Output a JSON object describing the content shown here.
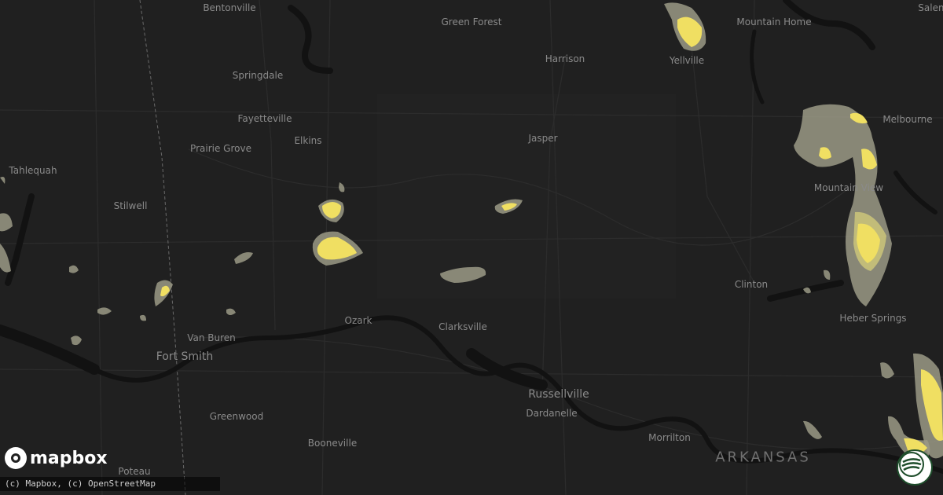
{
  "map": {
    "labels": [
      {
        "id": "bentonville",
        "text": "Bentonville"
      },
      {
        "id": "green-forest",
        "text": "Green Forest"
      },
      {
        "id": "mountain-home",
        "text": "Mountain Home"
      },
      {
        "id": "salem",
        "text": "Salem"
      },
      {
        "id": "harrison",
        "text": "Harrison"
      },
      {
        "id": "yellville",
        "text": "Yellville"
      },
      {
        "id": "springdale",
        "text": "Springdale"
      },
      {
        "id": "fayetteville",
        "text": "Fayetteville"
      },
      {
        "id": "melbourne",
        "text": "Melbourne"
      },
      {
        "id": "prairie-grove",
        "text": "Prairie Grove"
      },
      {
        "id": "elkins",
        "text": "Elkins"
      },
      {
        "id": "jasper",
        "text": "Jasper"
      },
      {
        "id": "tahlequah",
        "text": "Tahlequah"
      },
      {
        "id": "mountain-view",
        "text": "Mountain View"
      },
      {
        "id": "stilwell",
        "text": "Stilwell"
      },
      {
        "id": "clinton",
        "text": "Clinton"
      },
      {
        "id": "heber-springs",
        "text": "Heber Springs"
      },
      {
        "id": "ozark",
        "text": "Ozark"
      },
      {
        "id": "clarksville",
        "text": "Clarksville"
      },
      {
        "id": "van-buren",
        "text": "Van Buren"
      },
      {
        "id": "fort-smith",
        "text": "Fort Smith"
      },
      {
        "id": "russellville",
        "text": "Russellville"
      },
      {
        "id": "dardanelle",
        "text": "Dardanelle"
      },
      {
        "id": "greenwood",
        "text": "Greenwood"
      },
      {
        "id": "morrilton",
        "text": "Morrilton"
      },
      {
        "id": "booneville",
        "text": "Booneville"
      },
      {
        "id": "arkansas",
        "text": "ARKANSAS"
      },
      {
        "id": "poteau",
        "text": "Poteau"
      }
    ],
    "colors": {
      "background": "#202020",
      "water": "#111111",
      "road": "#2c2c2c",
      "boundary": "#6a6a6a",
      "label": "#8a8a8a",
      "swath_outer": "#9b9a86",
      "swath_mid": "#c9c27a",
      "swath_inner": "#f0df62"
    }
  },
  "branding": {
    "logo_text": "mapbox",
    "logo_icon": "mapbox-logo-icon",
    "attribution": "(c) Mapbox, (c) OpenStreetMap",
    "badge_icon": "globe-badge-icon"
  }
}
